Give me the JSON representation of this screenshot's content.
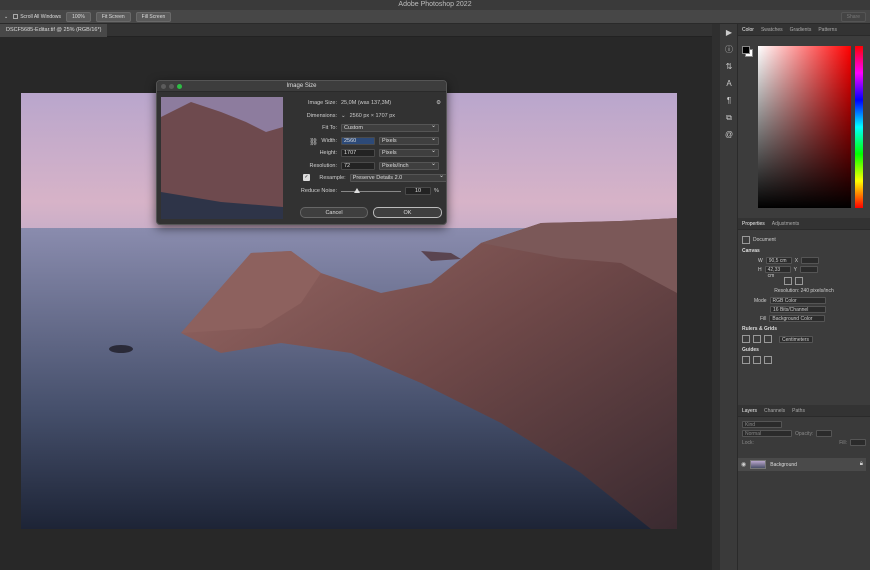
{
  "app": {
    "title": "Adobe Photoshop 2022"
  },
  "options": {
    "scroll_all": "Scroll All Windows",
    "zoom": "100%",
    "fit_screen": "Fit Screen",
    "fill_screen": "Fill Screen",
    "share": "Share"
  },
  "doc_tab": "DSCF5685-Editar.tif @ 25% (RGB/16*)",
  "dialog": {
    "title": "Image Size",
    "image_size_label": "Image Size:",
    "image_size_value": "25,0M (was 137,3M)",
    "dimensions_label": "Dimensions:",
    "dimensions_value": "2560 px  ×  1707 px",
    "fit_to_label": "Fit To:",
    "fit_to_value": "Custom",
    "width_label": "Width:",
    "width_value": "2560",
    "width_unit": "Pixels",
    "height_label": "Height:",
    "height_value": "1707",
    "height_unit": "Pixels",
    "resolution_label": "Resolution:",
    "resolution_value": "72",
    "resolution_unit": "Pixels/Inch",
    "resample_label": "Resample:",
    "resample_value": "Preserve Details 2.0",
    "reduce_noise_label": "Reduce Noise:",
    "reduce_noise_value": "10",
    "reduce_noise_unit": "%",
    "cancel": "Cancel",
    "ok": "OK"
  },
  "color_panel": {
    "tabs": [
      "Color",
      "Swatches",
      "Gradients",
      "Patterns"
    ]
  },
  "properties": {
    "tabs": [
      "Properties",
      "Adjustments"
    ],
    "doc_label": "Document",
    "canvas_title": "Canvas",
    "w_label": "W",
    "w_value": "90,5 cm",
    "x_label": "X",
    "h_label": "H",
    "h_value": "42,33 cm",
    "y_label": "Y",
    "resolution": "Resolution: 240 pixels/inch",
    "mode_label": "Mode",
    "mode_value": "RGB Color",
    "depth_value": "16 Bits/Channel",
    "fill_label": "Fill",
    "fill_value": "Background Color",
    "rulers_title": "Rulers & Grids",
    "rulers_unit": "Centimeters",
    "guides_title": "Guides"
  },
  "layers": {
    "tabs": [
      "Layers",
      "Channels",
      "Paths"
    ],
    "kind": "Kind",
    "blend": "Normal",
    "opacity_label": "Opacity:",
    "fill_label": "Fill:",
    "lock_label": "Lock:",
    "layer_name": "Background"
  }
}
